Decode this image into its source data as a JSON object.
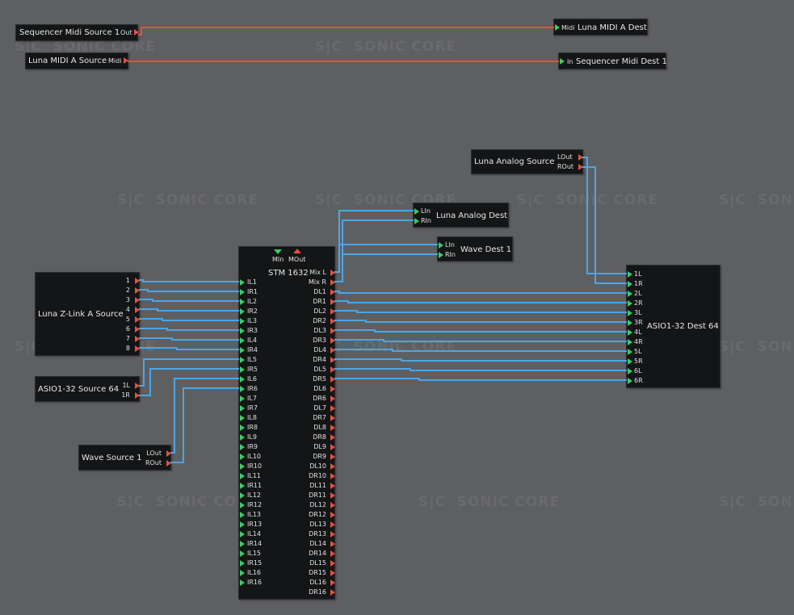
{
  "watermark": {
    "text": "SONIC CORE",
    "mark": "S|C"
  },
  "colors": {
    "background": "#5e5f61",
    "module": "#141516",
    "audio_wire": "#4aa6e8",
    "midi_wire": "#e0523f",
    "input_port": "#3ccd63",
    "output_port": "#e0523f"
  },
  "modules": {
    "seq_midi_source": {
      "title": "Sequencer Midi Source 1",
      "out_label": "Out"
    },
    "luna_midi_a_dest": {
      "title": "Luna MIDI A Dest",
      "in_label": "Midi"
    },
    "luna_midi_a_source": {
      "title": "Luna MIDI A Source",
      "out_label": "Midi"
    },
    "seq_midi_dest": {
      "title": "Sequencer Midi Dest 1",
      "in_label": "In"
    },
    "luna_analog_source": {
      "title": "Luna Analog Source",
      "outs": [
        "LOut",
        "ROut"
      ]
    },
    "luna_analog_dest": {
      "title": "Luna Analog Dest",
      "ins": [
        "LIn",
        "RIn"
      ]
    },
    "wave_dest": {
      "title": "Wave Dest 1",
      "ins": [
        "LIn",
        "RIn"
      ]
    },
    "zlink_source": {
      "title": "Luna Z-Link A Source",
      "outs": [
        "1",
        "2",
        "3",
        "4",
        "5",
        "6",
        "7",
        "8"
      ]
    },
    "asio_source": {
      "title": "ASIO1-32 Source 64",
      "outs": [
        "1L",
        "1R"
      ]
    },
    "wave_source": {
      "title": "Wave Source 1",
      "outs": [
        "LOut",
        "ROut"
      ]
    },
    "asio_dest": {
      "title": "ASIO1-32 Dest 64",
      "ins": [
        "1L",
        "1R",
        "2L",
        "2R",
        "3L",
        "3R",
        "4L",
        "4R",
        "5L",
        "5R",
        "6L",
        "6R"
      ]
    },
    "stm": {
      "title": "STM 1632",
      "midi_in": "MIn",
      "midi_out": "MOut",
      "inputs": [
        "IL1",
        "IR1",
        "IL2",
        "IR2",
        "IL3",
        "IR3",
        "IL4",
        "IR4",
        "IL5",
        "IR5",
        "IL6",
        "IR6",
        "IL7",
        "IR7",
        "IL8",
        "IR8",
        "IL9",
        "IR9",
        "IL10",
        "IR10",
        "IL11",
        "IR11",
        "IL12",
        "IR12",
        "IL13",
        "IR13",
        "IL14",
        "IR14",
        "IL15",
        "IR15",
        "IL16",
        "IR16"
      ],
      "outputs": [
        "Mix L",
        "Mix R",
        "DL1",
        "DR1",
        "DL2",
        "DR2",
        "DL3",
        "DR3",
        "DL4",
        "DR4",
        "DL5",
        "DR5",
        "DL6",
        "DR6",
        "DL7",
        "DR7",
        "DL8",
        "DR8",
        "DL9",
        "DR9",
        "DL10",
        "DR10",
        "DL11",
        "DR11",
        "DL12",
        "DR12",
        "DL13",
        "DR13",
        "DL14",
        "DR14",
        "DL15",
        "DR15",
        "DL16",
        "DR16"
      ]
    }
  }
}
